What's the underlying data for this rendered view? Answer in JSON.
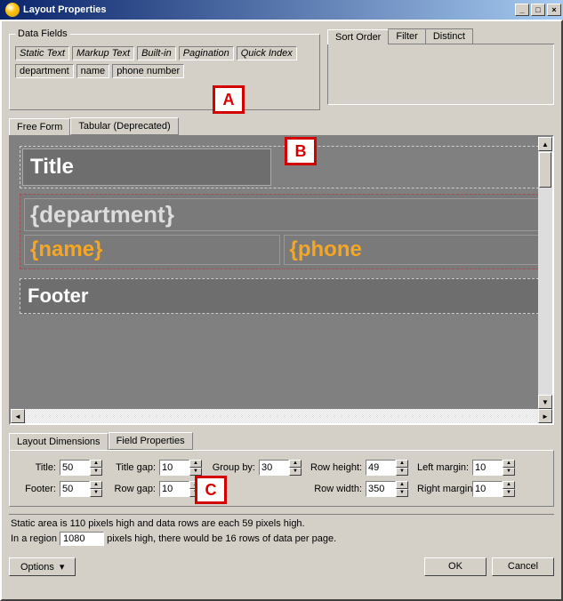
{
  "title": "Layout Properties",
  "dataFields": {
    "legend": "Data Fields",
    "builtins": [
      "Static Text",
      "Markup Text",
      "Built-in",
      "Pagination",
      "Quick Index"
    ],
    "fields": [
      "department",
      "name",
      "phone number"
    ]
  },
  "sortTabs": {
    "sortOrder": "Sort Order",
    "filter": "Filter",
    "distinct": "Distinct"
  },
  "midTabs": {
    "freeForm": "Free Form",
    "tabular": "Tabular (Deprecated)"
  },
  "canvas": {
    "title": "Title",
    "dept": "{department}",
    "name": "{name}",
    "phone": "{phone",
    "footer": "Footer"
  },
  "bottomTabs": {
    "dims": "Layout Dimensions",
    "fieldProps": "Field Properties"
  },
  "dims": {
    "titleLbl": "Title:",
    "titleVal": "50",
    "titleGapLbl": "Title gap:",
    "titleGapVal": "10",
    "groupByLbl": "Group by:",
    "groupByVal": "30",
    "rowHeightLbl": "Row height:",
    "rowHeightVal": "49",
    "leftMarginLbl": "Left margin:",
    "leftMarginVal": "10",
    "footerLbl": "Footer:",
    "footerVal": "50",
    "rowGapLbl": "Row gap:",
    "rowGapVal": "10",
    "rowWidthLbl": "Row width:",
    "rowWidthVal": "350",
    "rightMarginLbl": "Right margin:",
    "rightMarginVal": "10"
  },
  "static": {
    "line1": "Static area is 110 pixels high and data rows are each 59 pixels high.",
    "line2a": "In a region",
    "regionVal": "1080",
    "line2b": "pixels high, there would be 16 rows of data per page."
  },
  "buttons": {
    "options": "Options",
    "ok": "OK",
    "cancel": "Cancel"
  },
  "callouts": {
    "a": "A",
    "b": "B",
    "c": "C"
  }
}
